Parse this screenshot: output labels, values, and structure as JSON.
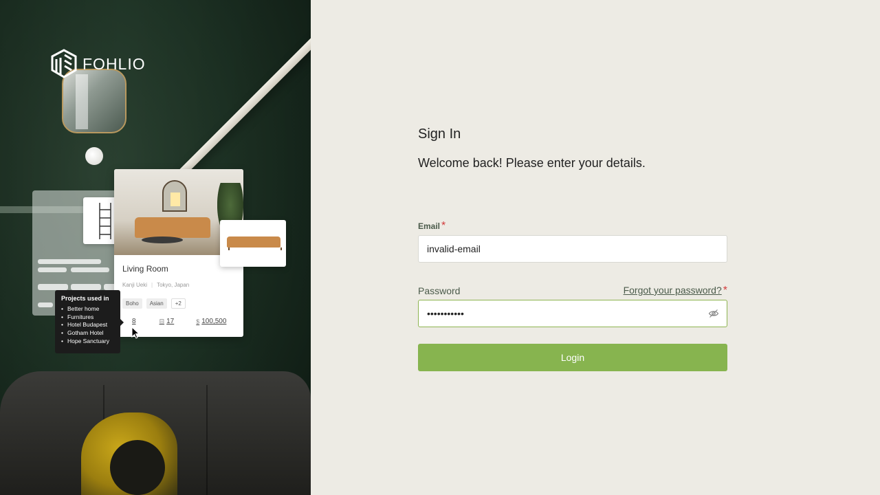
{
  "brand": {
    "name": "FOHLIO"
  },
  "hero": {
    "card": {
      "title": "Living Room",
      "designer": "Kanji Ueki",
      "location": "Tokyo, Japan",
      "tags": [
        "Boho",
        "Asian"
      ],
      "more_tags": "+2",
      "stats": {
        "projects": "8",
        "items": "17",
        "budget": "100,500"
      }
    },
    "tooltip": {
      "title": "Projects used in",
      "items": [
        "Better home",
        "Furnitures",
        "Hotel Budapest",
        "Gotham Hotel",
        "Hope Sanctuary"
      ]
    }
  },
  "form": {
    "title": "Sign In",
    "subtitle": "Welcome back! Please enter your details.",
    "email": {
      "label": "Email",
      "required_mark": "*",
      "value": "invalid-email"
    },
    "password": {
      "label": "Password",
      "required_mark": "*",
      "value": "•••••••••••",
      "forgot_link": "Forgot your password?"
    },
    "login_button": "Login"
  },
  "colors": {
    "accent": "#87b44f",
    "required": "#d23b3b",
    "panel_bg": "#edebe4"
  }
}
